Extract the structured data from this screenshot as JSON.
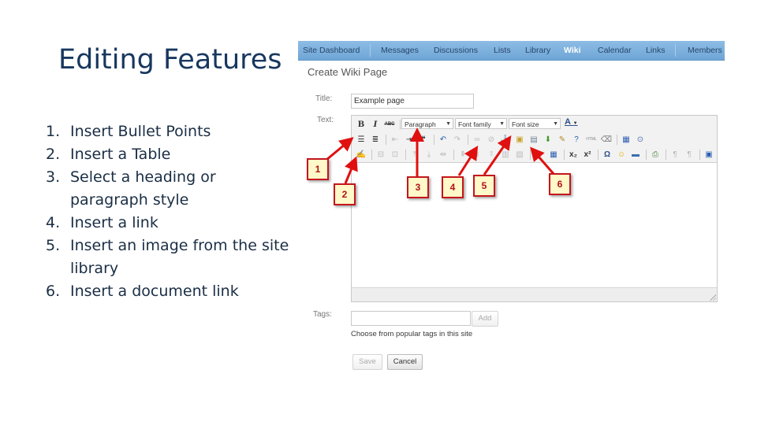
{
  "slide": {
    "title": "Editing Features",
    "features": [
      {
        "num": "1.",
        "text": "Insert Bullet Points"
      },
      {
        "num": "2.",
        "text": "Insert a Table"
      },
      {
        "num": "3.",
        "text": "Select a heading or paragraph style"
      },
      {
        "num": "4.",
        "text": "Insert a link"
      },
      {
        "num": "5.",
        "text": "Insert an image from the site library"
      },
      {
        "num": "6.",
        "text": "Insert a document link"
      }
    ]
  },
  "nav": {
    "items": [
      {
        "label": "Site Dashboard"
      },
      {
        "label": "Messages"
      },
      {
        "label": "Discussions"
      },
      {
        "label": "Lists"
      },
      {
        "label": "Library"
      },
      {
        "label": "Wiki",
        "active": true
      },
      {
        "label": "Calendar"
      },
      {
        "label": "Links"
      },
      {
        "label": "Members"
      }
    ]
  },
  "form": {
    "page_title": "Create Wiki Page",
    "title_label": "Title:",
    "title_value": "Example page",
    "text_label": "Text:",
    "tags_label": "Tags:",
    "tags_value": "",
    "add_button": "Add",
    "tags_hint": "Choose from popular tags in this site",
    "save_button": "Save",
    "cancel_button": "Cancel"
  },
  "toolbar": {
    "bold": "B",
    "italic": "I",
    "strike": "ABC",
    "paragraph_select": "Paragraph",
    "font_family_select": "Font family",
    "font_size_select": "Font size",
    "font_color": "A",
    "html_label": "HTML",
    "subscript": "x₂",
    "superscript": "x²",
    "special_char": "Ω"
  },
  "callouts": [
    "1",
    "2",
    "3",
    "4",
    "5",
    "6"
  ],
  "colors": {
    "nav_bg": "#7ab0dc",
    "callout_border": "#c4161c",
    "callout_fill": "#fff8c8",
    "title_color": "#17375e"
  }
}
